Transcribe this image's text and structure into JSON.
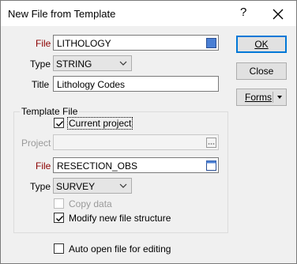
{
  "window": {
    "title": "New File from Template"
  },
  "titlebar": {
    "help_glyph": "?"
  },
  "form": {
    "file_label": "File",
    "file_value": "LITHOLOGY",
    "type_label": "Type",
    "type_value": "STRING",
    "title_label": "Title",
    "title_value": "Lithology Codes"
  },
  "template_file": {
    "group_title": "Template File",
    "current_project_label": "Current project",
    "current_project_checked": true,
    "project_label": "Project",
    "project_value": "",
    "file_label": "File",
    "file_value": "RESECTION_OBS",
    "type_label": "Type",
    "type_value": "SURVEY",
    "copy_data_label": "Copy data",
    "copy_data_checked": false,
    "modify_structure_label": "Modify new file structure",
    "modify_structure_checked": true
  },
  "auto_open_label": "Auto open file for editing",
  "auto_open_checked": false,
  "buttons": {
    "ok_label": "OK",
    "close_label": "Close",
    "forms_label": "Forms"
  },
  "colors": {
    "accent": "#0078d7",
    "required_label": "#8b0000"
  }
}
